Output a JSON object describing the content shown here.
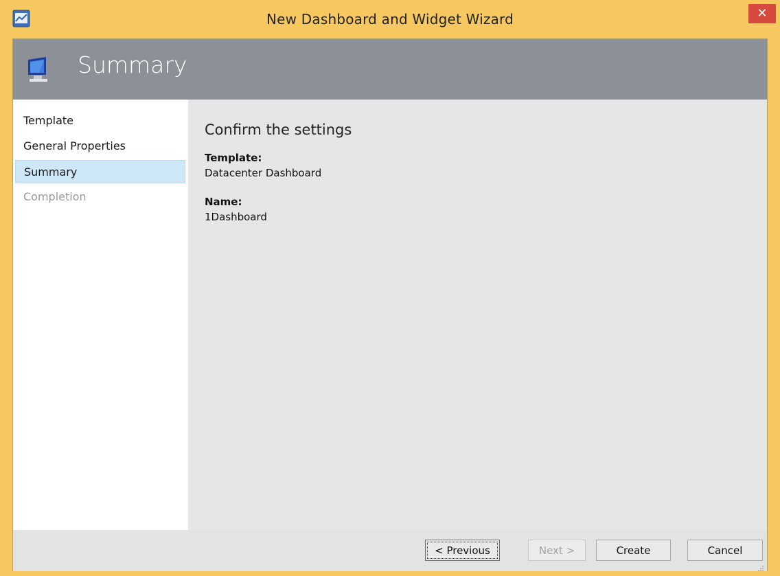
{
  "window": {
    "title": "New Dashboard and Widget Wizard",
    "close_label": "✕"
  },
  "header": {
    "title": "Summary"
  },
  "sidebar": {
    "items": [
      {
        "label": "Template",
        "state": "normal"
      },
      {
        "label": "General Properties",
        "state": "normal"
      },
      {
        "label": "Summary",
        "state": "selected"
      },
      {
        "label": "Completion",
        "state": "disabled"
      }
    ]
  },
  "main": {
    "heading": "Confirm the settings",
    "fields": [
      {
        "label": "Template:",
        "value": "Datacenter Dashboard"
      },
      {
        "label": "Name:",
        "value": "1Dashboard"
      }
    ]
  },
  "footer": {
    "previous_label": "< Previous",
    "next_label": "Next >",
    "create_label": "Create",
    "cancel_label": "Cancel"
  },
  "colors": {
    "window_border": "#f6c85f",
    "header_bg": "#8c9097",
    "selected_item": "#cfe8f7",
    "close_button": "#d64b3d"
  },
  "icons": {
    "app": "chart-window-icon",
    "header": "monitor-icon"
  }
}
